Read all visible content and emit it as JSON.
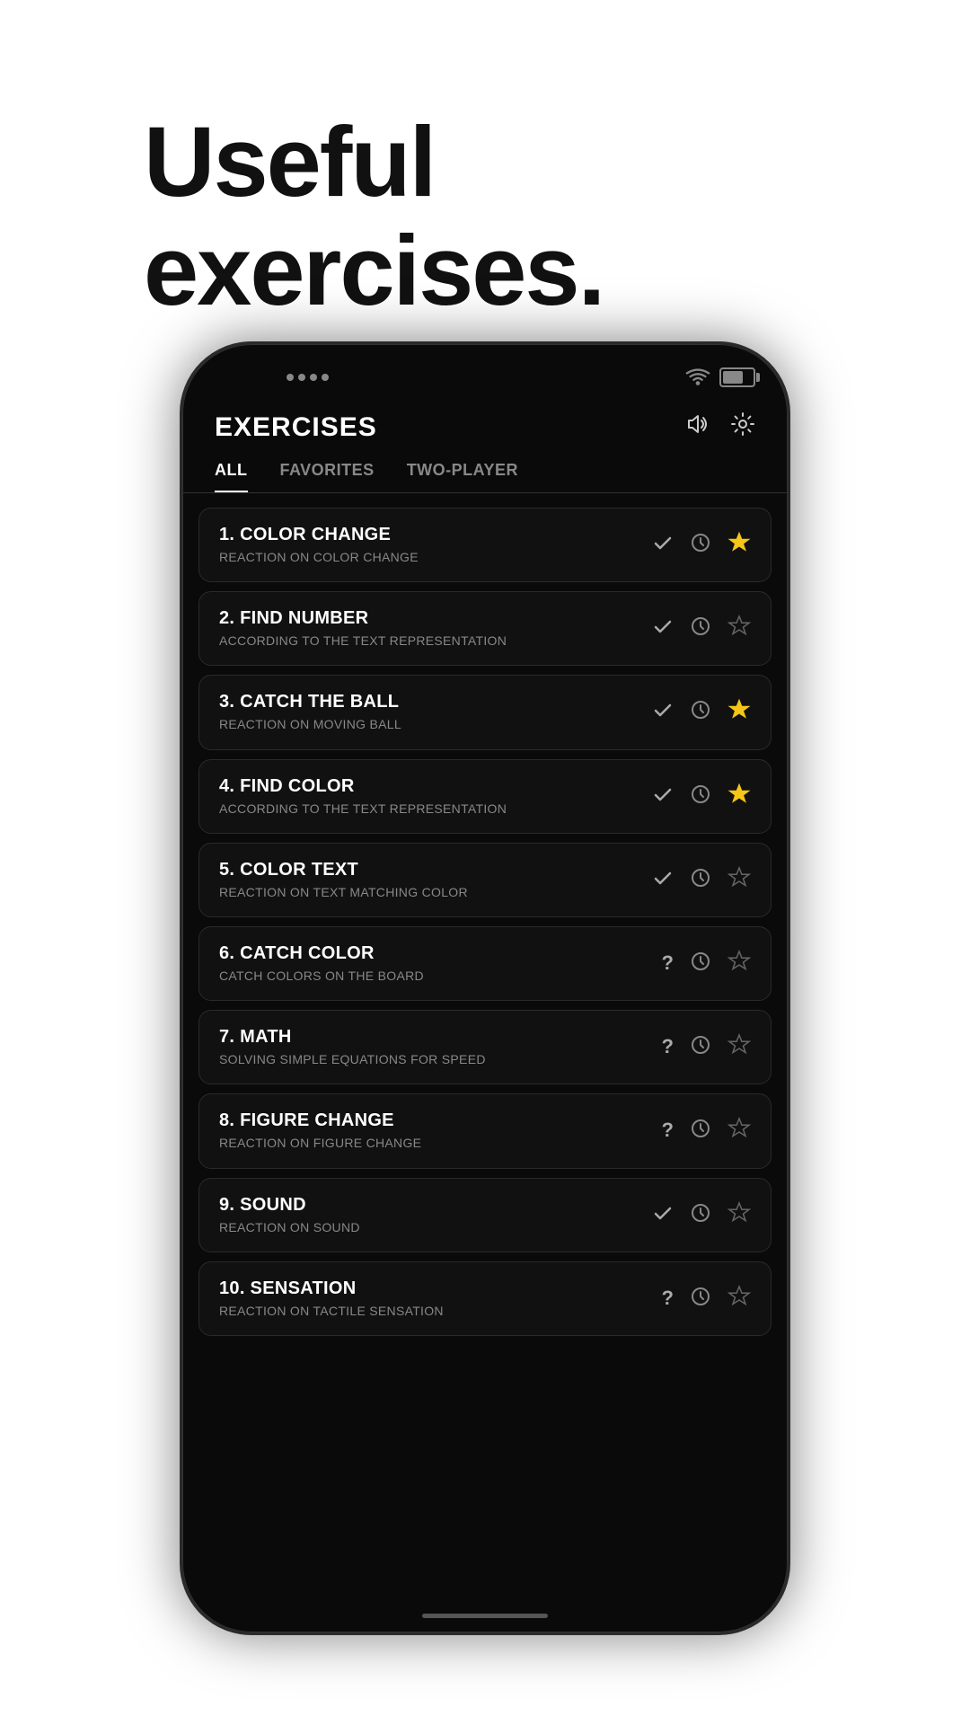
{
  "hero": {
    "line1": "Useful",
    "line2": "exercises."
  },
  "app": {
    "title": "EXERCISES",
    "sound_icon": "🔊",
    "settings_icon": "⚙"
  },
  "tabs": [
    {
      "label": "ALL",
      "active": true
    },
    {
      "label": "FAVORITES",
      "active": false
    },
    {
      "label": "TWO-PLAYER",
      "active": false
    }
  ],
  "exercises": [
    {
      "number": "1.",
      "name": "COLOR CHANGE",
      "desc": "REACTION ON COLOR CHANGE",
      "status": "check",
      "starred": true
    },
    {
      "number": "2.",
      "name": "FIND NUMBER",
      "desc": "ACCORDING TO THE TEXT REPRESENTATION",
      "status": "check",
      "starred": false
    },
    {
      "number": "3.",
      "name": "CATCH THE BALL",
      "desc": "REACTION ON MOVING BALL",
      "status": "check",
      "starred": true
    },
    {
      "number": "4.",
      "name": "FIND COLOR",
      "desc": "ACCORDING TO THE TEXT REPRESENTATION",
      "status": "check",
      "starred": true
    },
    {
      "number": "5.",
      "name": "COLOR TEXT",
      "desc": "REACTION ON TEXT MATCHING COLOR",
      "status": "check",
      "starred": false
    },
    {
      "number": "6.",
      "name": "CATCH COLOR",
      "desc": "CATCH COLORS ON THE BOARD",
      "status": "question",
      "starred": false
    },
    {
      "number": "7.",
      "name": "MATH",
      "desc": "SOLVING SIMPLE EQUATIONS FOR SPEED",
      "status": "question",
      "starred": false
    },
    {
      "number": "8.",
      "name": "FIGURE CHANGE",
      "desc": "REACTION ON FIGURE CHANGE",
      "status": "question",
      "starred": false
    },
    {
      "number": "9.",
      "name": "SOUND",
      "desc": "REACTION ON SOUND",
      "status": "check",
      "starred": false
    },
    {
      "number": "10.",
      "name": "SENSATION",
      "desc": "REACTION ON TACTILE SENSATION",
      "status": "question",
      "starred": false
    }
  ]
}
